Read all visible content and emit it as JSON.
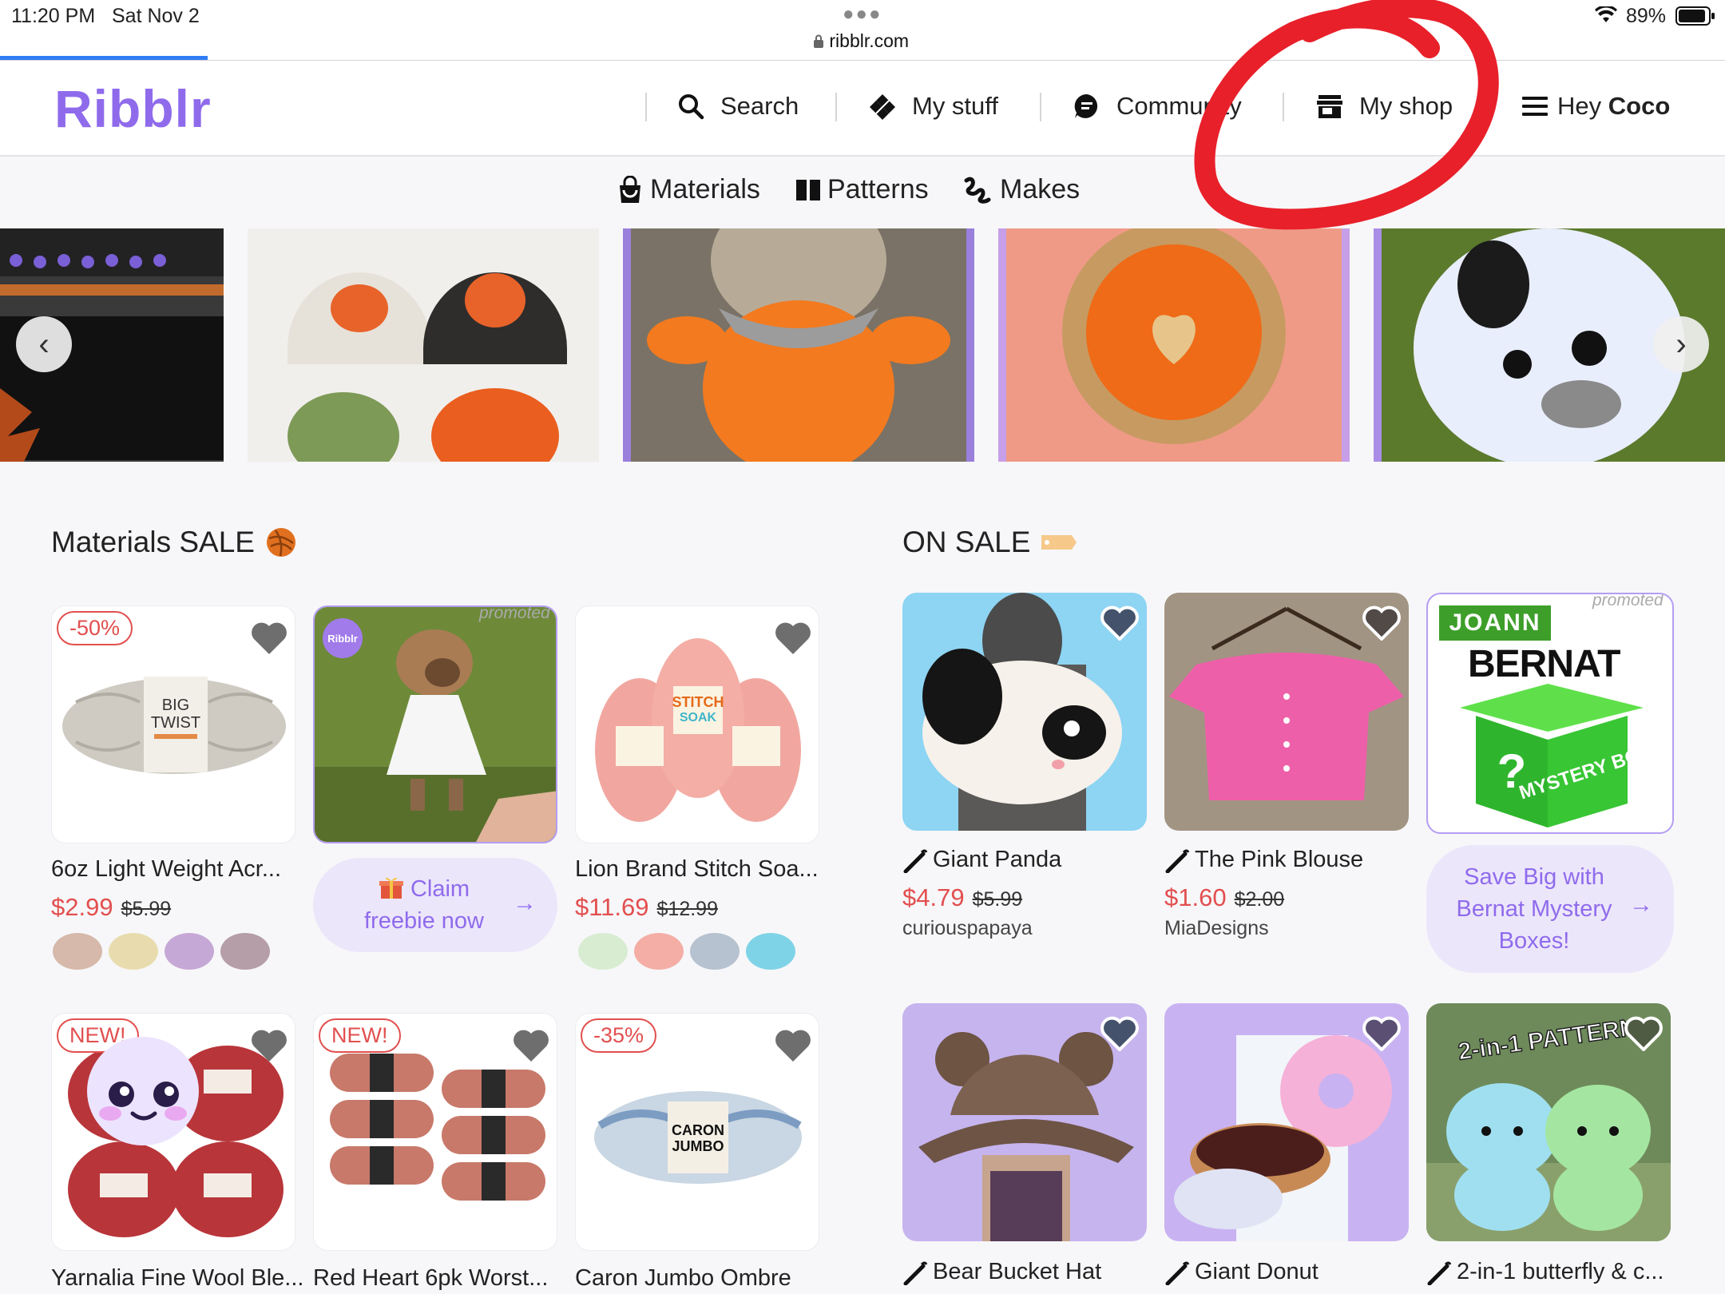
{
  "status": {
    "time": "11:20 PM",
    "date": "Sat Nov 2",
    "url": "ribblr.com",
    "battery": "89%"
  },
  "header": {
    "logo": "Ribblr",
    "nav": {
      "search": "Search",
      "my_stuff": "My stuff",
      "community": "Community",
      "my_shop": "My shop",
      "greeting_prefix": "Hey",
      "greeting_name": "Coco"
    }
  },
  "subnav": {
    "materials": "Materials",
    "patterns": "Patterns",
    "makes": "Makes"
  },
  "carousel": {
    "prev_label": "‹",
    "next_label": "›"
  },
  "materials_sale": {
    "title": "Materials SALE",
    "items": [
      {
        "badge": "-50%",
        "title": "6oz Light Weight Acr...",
        "price": "$2.99",
        "old_price": "$5.99"
      },
      {
        "title": "Claim freebie now",
        "line1": "Claim",
        "line2": "freebie now",
        "promoted": "promoted",
        "brand": "Ribblr"
      },
      {
        "title": "Lion Brand Stitch Soa...",
        "price": "$11.69",
        "old_price": "$12.99"
      },
      {
        "badge": "NEW!",
        "title": "Yarnalia Fine Wool Ble..."
      },
      {
        "badge": "NEW!",
        "title": "Red Heart 6pk Worst..."
      },
      {
        "badge": "-35%",
        "title": "Caron Jumbo Ombre"
      }
    ]
  },
  "on_sale": {
    "title": "ON SALE",
    "items": [
      {
        "title": "Giant Panda",
        "price": "$4.79",
        "old_price": "$5.99",
        "seller": "curiouspapaya"
      },
      {
        "title": "The Pink Blouse",
        "price": "$1.60",
        "old_price": "$2.00",
        "seller": "MiaDesigns"
      },
      {
        "promoted": "promoted",
        "brand_top": "JOANN",
        "brand": "BERNAT",
        "box_text": "MYSTERY BOX",
        "line1": "Save Big with",
        "line2": "Bernat Mystery",
        "line3": "Boxes!"
      },
      {
        "title": "Bear Bucket Hat"
      },
      {
        "title": "Giant Donut"
      },
      {
        "title": "2-in-1 butterfly & c...",
        "image_text": "2-in-1 PATTERN"
      }
    ]
  },
  "colors": {
    "brand": "#8f6bec",
    "sale": "#e24f4f",
    "annotation": "#e8202a"
  }
}
